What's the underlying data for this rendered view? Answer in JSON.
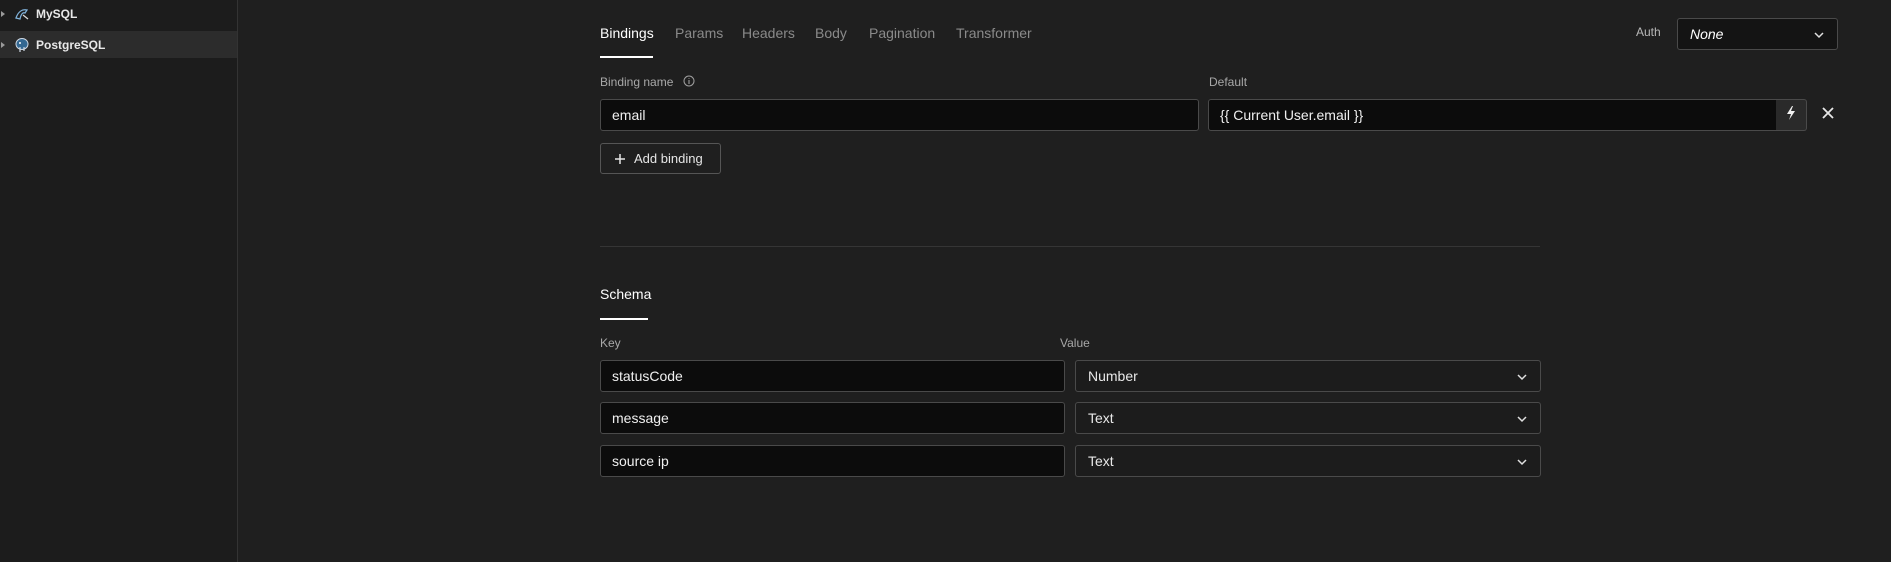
{
  "sidebar": {
    "items": [
      {
        "label": "MySQL",
        "icon": "mysql-icon"
      },
      {
        "label": "PostgreSQL",
        "icon": "postgresql-icon"
      }
    ]
  },
  "tabs": [
    {
      "label": "Bindings",
      "active": true
    },
    {
      "label": "Params"
    },
    {
      "label": "Headers"
    },
    {
      "label": "Body"
    },
    {
      "label": "Pagination"
    },
    {
      "label": "Transformer"
    }
  ],
  "auth": {
    "label": "Auth",
    "value": "None"
  },
  "bindings": {
    "name_label": "Binding name",
    "default_label": "Default",
    "name_value": "email",
    "default_value": "{{ Current User.email }}",
    "add_label": "Add binding"
  },
  "schema": {
    "title": "Schema",
    "key_label": "Key",
    "value_label": "Value",
    "rows": [
      {
        "key": "statusCode",
        "value": "Number"
      },
      {
        "key": "message",
        "value": "Text"
      },
      {
        "key": "source ip",
        "value": "Text"
      }
    ]
  },
  "colors": {
    "background": "#1f1f1f",
    "input_bg": "#0c0c0c",
    "border": "#4a4a4a",
    "active_tab": "#ffffff",
    "inactive_tab": "#8a8a8a"
  }
}
